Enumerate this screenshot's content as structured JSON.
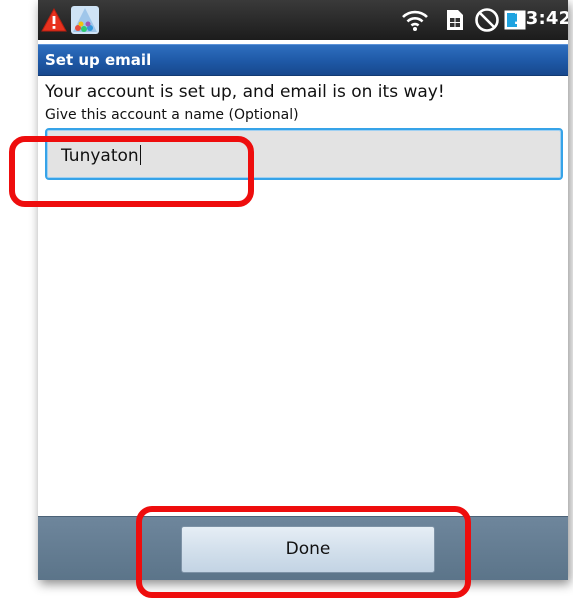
{
  "status_bar": {
    "time": "13:42",
    "icons": [
      "warning-icon",
      "app-icon",
      "wifi-icon",
      "sim-card-icon",
      "blocked-icon",
      "battery-icon"
    ]
  },
  "header": {
    "title": "Set up email"
  },
  "main": {
    "message": "Your account is set up, and email is on its way!",
    "field_label": "Give this account a name (Optional)",
    "account_name_value": "Tunyaton"
  },
  "footer": {
    "done_label": "Done"
  },
  "colors": {
    "title_bar": "#1e58a6",
    "input_focus_border": "#36a3e8",
    "highlight": "#ee0d0d",
    "bottom_bar": "#5b7489"
  }
}
